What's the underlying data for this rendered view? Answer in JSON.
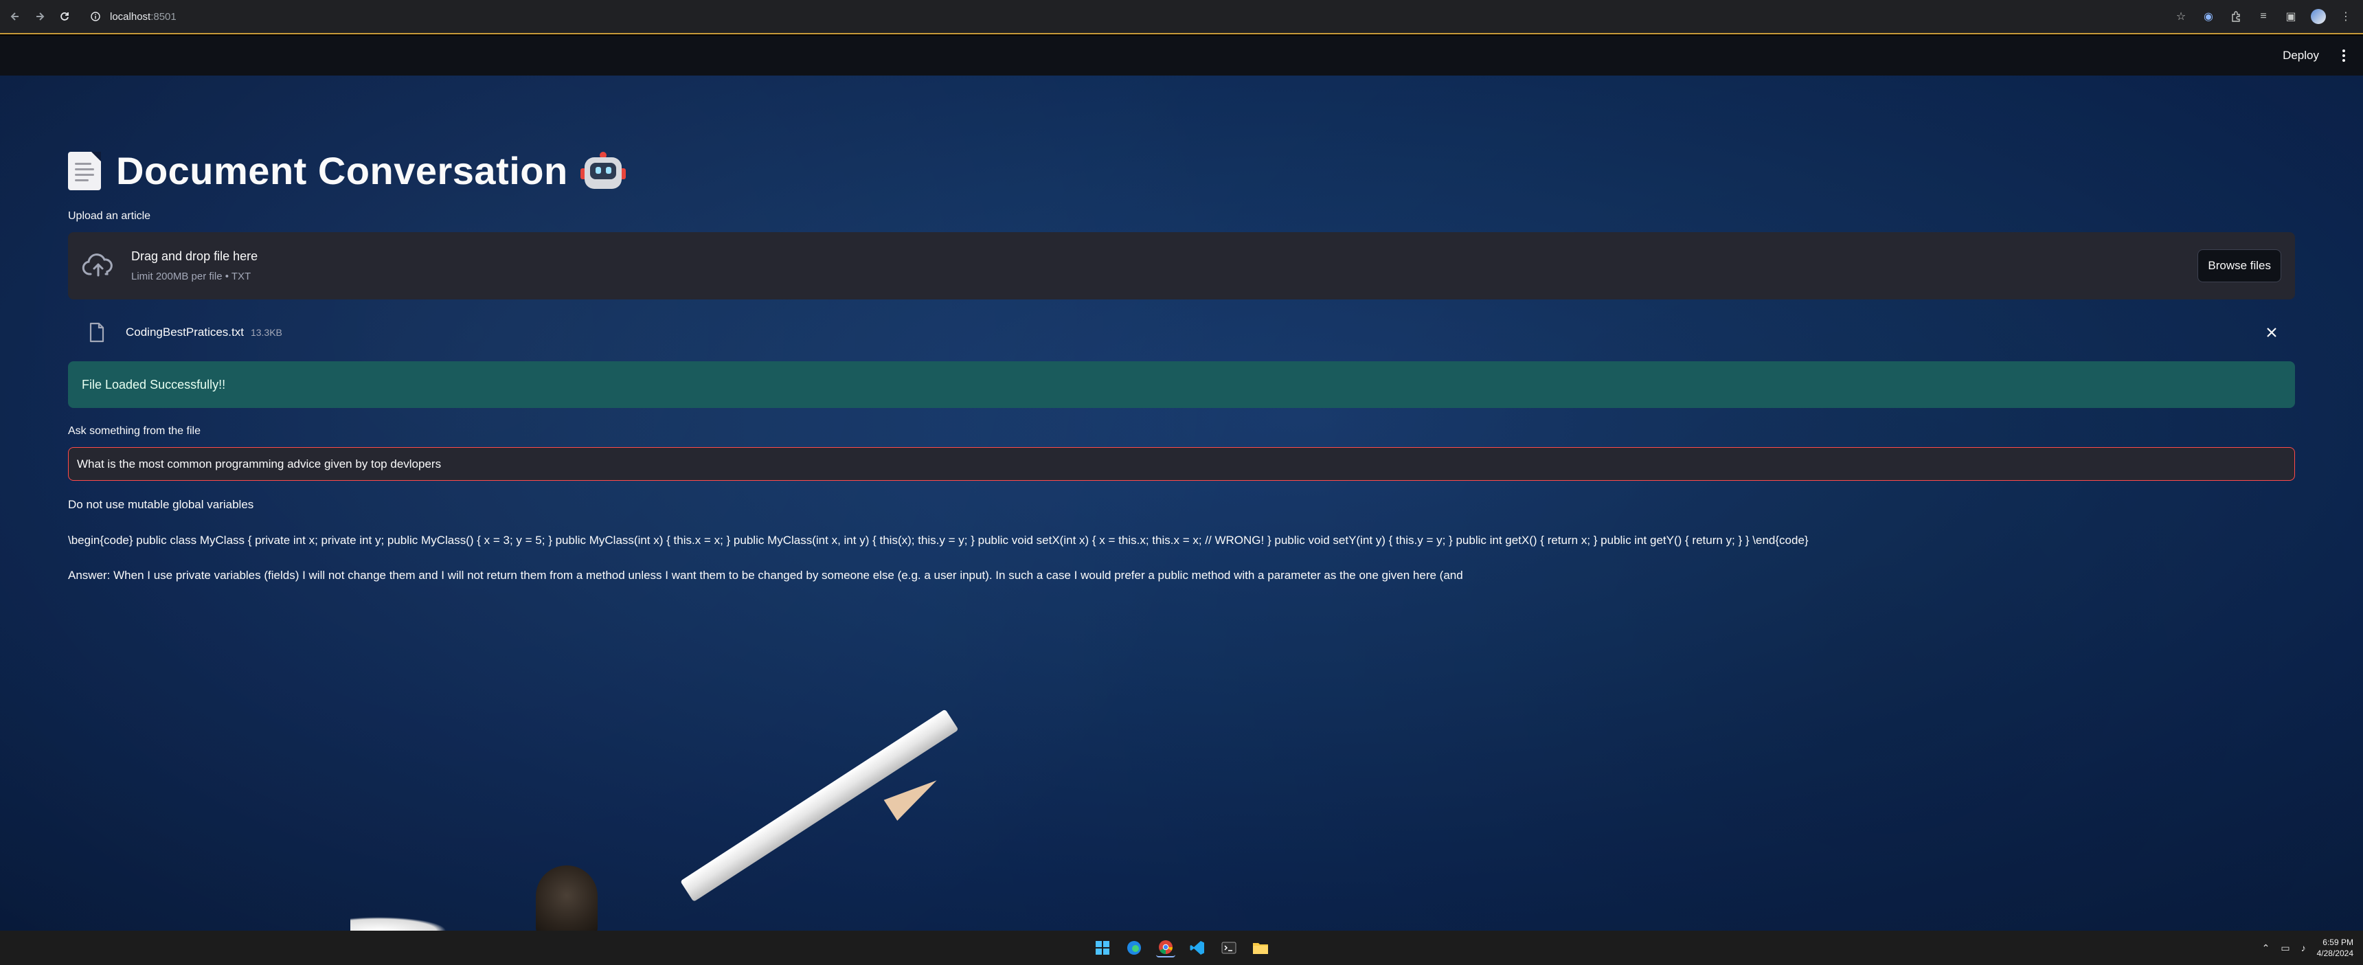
{
  "browser": {
    "url_host": "localhost",
    "url_port": ":8501"
  },
  "streamlit_header": {
    "deploy_label": "Deploy"
  },
  "page": {
    "title": "Document Conversation"
  },
  "uploader": {
    "label": "Upload an article",
    "drop_text": "Drag and drop file here",
    "limit_text": "Limit 200MB per file • TXT",
    "browse_label": "Browse files"
  },
  "uploaded_file": {
    "name": "CodingBestPratices.txt",
    "size": "13.3KB"
  },
  "status": {
    "success_message": "File Loaded Successfully!!"
  },
  "question": {
    "label": "Ask something from the file",
    "value": "What is the most common programming advice given by top devlopers"
  },
  "answer": {
    "line1": "Do not use mutable global variables",
    "line2": "\\begin{code} public class MyClass { private int x; private int y; public MyClass() { x = 3; y = 5; } public MyClass(int x) { this.x = x; } public MyClass(int x, int y) { this(x); this.y = y; } public void setX(int x) { x = this.x; this.x = x; // WRONG! } public void setY(int y) { this.y = y; } public int getX() { return x; } public int getY() { return y; } } \\end{code}",
    "line3": "Answer: When I use private variables (fields) I will not change them and I will not return them from a method unless I want them to be changed by someone else (e.g. a user input). In such a case I would prefer a public method with a parameter as the one given here (and"
  },
  "taskbar": {
    "time": "6:59 PM",
    "date": "4/28/2024"
  },
  "colors": {
    "accent_red": "#ff4b4b",
    "success_bg": "#1a5b5c",
    "widget_bg": "#262730"
  }
}
